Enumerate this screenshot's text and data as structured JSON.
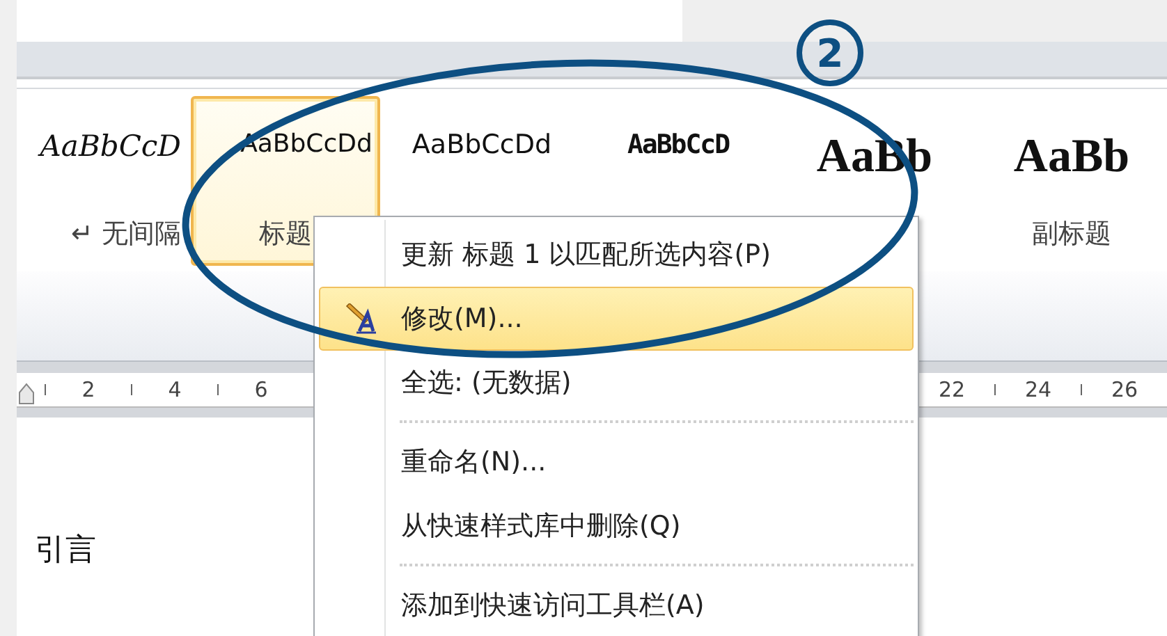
{
  "styles_gallery": [
    {
      "kind": "script",
      "sample": "AaBbCcD",
      "label": "↵ 无间隔",
      "selected": false
    },
    {
      "kind": "normal",
      "sample": "AaBbCcDd",
      "label": "标题",
      "selected": true
    },
    {
      "kind": "normal",
      "sample": "AaBbCcDd",
      "selected": false
    },
    {
      "kind": "bold",
      "sample": "AaBbCcD",
      "selected": false
    },
    {
      "kind": "title",
      "sample": "AaBb",
      "selected": false
    },
    {
      "kind": "title",
      "sample": "AaBb",
      "label": "副标题",
      "selected": false
    }
  ],
  "ruler": {
    "left_labels": [
      "2",
      "4",
      "6"
    ],
    "right_labels": [
      "22",
      "24",
      "26"
    ]
  },
  "document": {
    "text": "引言"
  },
  "context_menu": [
    {
      "kind": "item",
      "label": "更新 标题 1 以匹配所选内容(P)",
      "selected": false,
      "icon": false
    },
    {
      "kind": "item",
      "label": "修改(M)...",
      "selected": true,
      "icon": true
    },
    {
      "kind": "item",
      "label": "全选: (无数据)",
      "selected": false,
      "icon": false
    },
    {
      "kind": "separator"
    },
    {
      "kind": "item",
      "label": "重命名(N)...",
      "selected": false,
      "icon": false
    },
    {
      "kind": "item",
      "label": "从快速样式库中删除(Q)",
      "selected": false,
      "icon": false
    },
    {
      "kind": "separator"
    },
    {
      "kind": "item",
      "label": "添加到快速访问工具栏(A)",
      "selected": false,
      "icon": false
    }
  ],
  "annotation": {
    "number": "2"
  }
}
